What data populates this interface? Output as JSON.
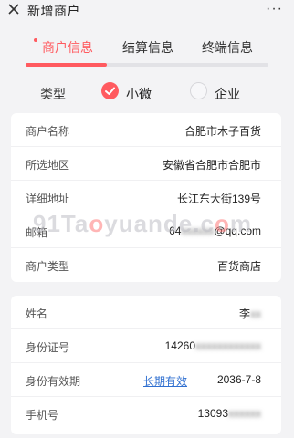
{
  "header": {
    "title": "新增商户",
    "more": "···"
  },
  "tabs": [
    {
      "label": "商户信息",
      "active": true
    },
    {
      "label": "结算信息",
      "active": false
    },
    {
      "label": "终端信息",
      "active": false
    }
  ],
  "progress": {
    "completed_fraction": 0.333
  },
  "type_selector": {
    "label": "类型",
    "options": [
      {
        "label": "小微",
        "selected": true
      },
      {
        "label": "企业",
        "selected": false
      }
    ]
  },
  "merchant_card": {
    "rows": [
      {
        "label": "商户名称",
        "value": "合肥市木子百货"
      },
      {
        "label": "所选地区",
        "value": "安徽省合肥市合肥市"
      },
      {
        "label": "详细地址",
        "value": "长江东大街139号"
      },
      {
        "label": "邮箱",
        "value_start": "64",
        "value_masked": "xxxxxx",
        "value_end": "@qq.com"
      },
      {
        "label": "商户类型",
        "value": "百货商店"
      }
    ]
  },
  "identity_card": {
    "rows": [
      {
        "label": "姓名",
        "value_start": "李",
        "value_masked": "xx"
      },
      {
        "label": "身份证号",
        "value_start": "14260",
        "value_masked": "xxxxxxxxxxxx"
      },
      {
        "label": "身份有效期",
        "link": "长期有效",
        "value": "2036-7-8"
      },
      {
        "label": "手机号",
        "value_start": "13093",
        "value_masked": "xxxxxx"
      }
    ]
  },
  "watermark": {
    "text_a": "91Ta",
    "text_o": "o",
    "text_b": "yuande.c",
    "text_o2": "o",
    "text_c": "m"
  },
  "colors": {
    "accent": "#ff5a5f",
    "link": "#2f6fd0",
    "background": "#f3f3f5"
  }
}
